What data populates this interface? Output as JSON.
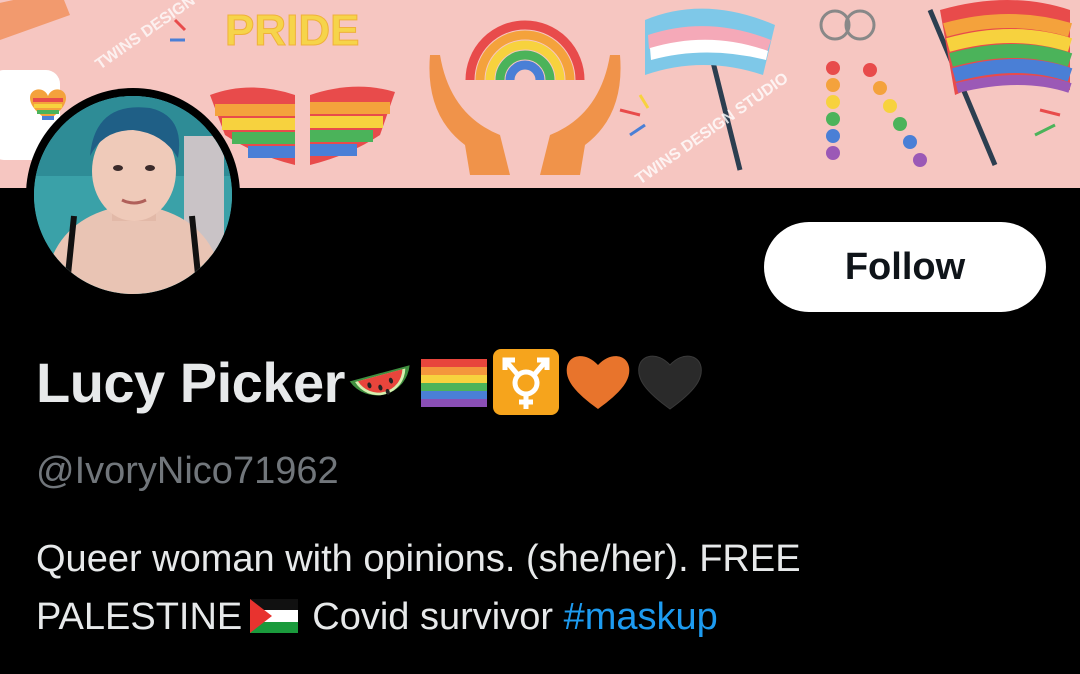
{
  "banner": {
    "pride_text": "PRIDE",
    "watermark_1": "TWINS DESIGN",
    "watermark_2": "TWINS DESIGN STUDIO",
    "background_color": "#f6c6c1"
  },
  "profile": {
    "display_name": "Lucy Picker",
    "name_emojis": [
      "watermelon-icon",
      "rainbow-flag-icon",
      "transgender-symbol-icon",
      "orange-heart-icon",
      "black-heart-icon"
    ],
    "handle": "@IvoryNico71962",
    "follow_label": "Follow",
    "bio": {
      "line_1": "Queer woman with opinions. (she/her). FREE",
      "line_2_a": "PALESTINE",
      "flag": "palestine-flag-icon",
      "line_2_b": "Covid survivor",
      "hashtag": "#maskup"
    }
  },
  "colors": {
    "background": "#000000",
    "primary_text": "#e7e9ea",
    "secondary_text": "#71767b",
    "link": "#1d9bf0",
    "follow_button_bg": "#ffffff"
  }
}
